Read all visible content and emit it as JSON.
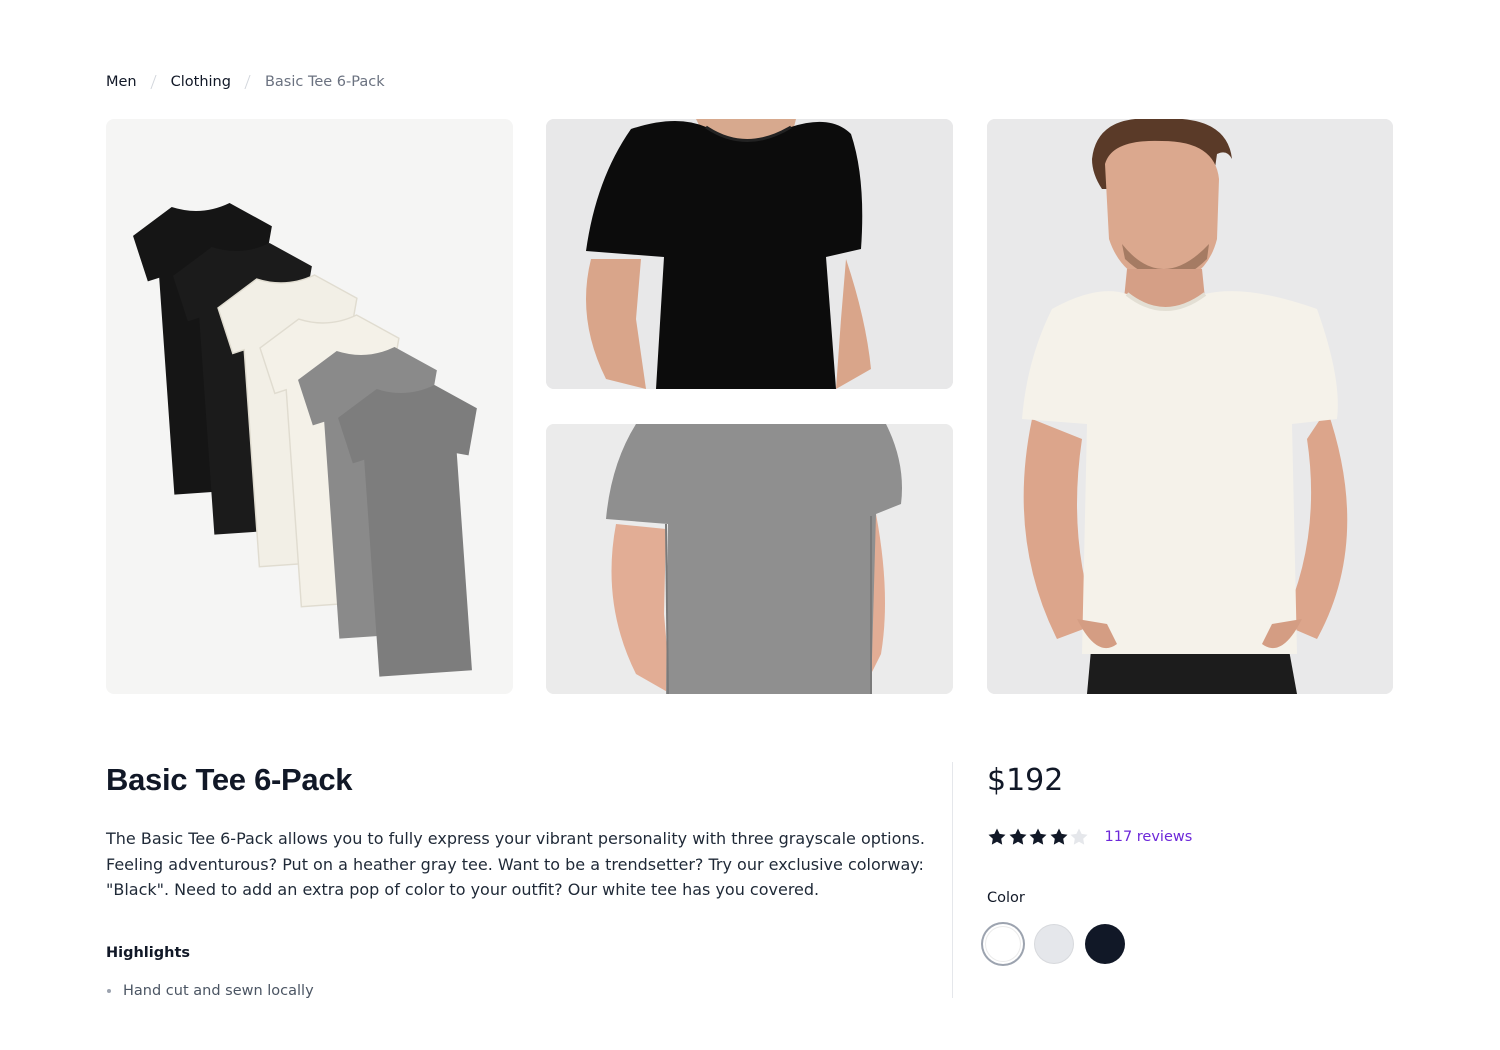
{
  "breadcrumb": {
    "items": [
      "Men",
      "Clothing"
    ],
    "current": "Basic Tee 6-Pack"
  },
  "gallery": {
    "images": [
      {
        "subject": "six folded tees: two black, two white, two heather gray",
        "icon": "tee-stack-image"
      },
      {
        "subject": "man wearing black tee, cropped torso",
        "icon": "black-tee-image"
      },
      {
        "subject": "man wearing heather gray tee, cropped torso",
        "icon": "gray-tee-image"
      },
      {
        "subject": "man wearing white tee",
        "icon": "white-tee-image"
      }
    ]
  },
  "product": {
    "title": "Basic Tee 6-Pack",
    "description": "The Basic Tee 6-Pack allows you to fully express your vibrant personality with three grayscale options. Feeling adventurous? Put on a heather gray tee. Want to be a trendsetter? Try our exclusive colorway: \"Black\". Need to add an extra pop of color to your outfit? Our white tee has you covered.",
    "highlights_heading": "Highlights",
    "highlights": [
      "Hand cut and sewn locally"
    ],
    "price": "$192",
    "rating": 4,
    "rating_max": 5,
    "reviews_label": "117 reviews",
    "color_label": "Color",
    "colors": [
      {
        "name": "White",
        "hex": "#ffffff",
        "selected": true
      },
      {
        "name": "Gray",
        "hex": "#e5e7eb",
        "selected": false
      },
      {
        "name": "Black",
        "hex": "#111827",
        "selected": false
      }
    ]
  },
  "theme": {
    "accent": "#6d28d9",
    "text": "#111827",
    "muted": "#6b7280",
    "star_filled": "#111827",
    "star_empty": "#e5e7eb"
  }
}
